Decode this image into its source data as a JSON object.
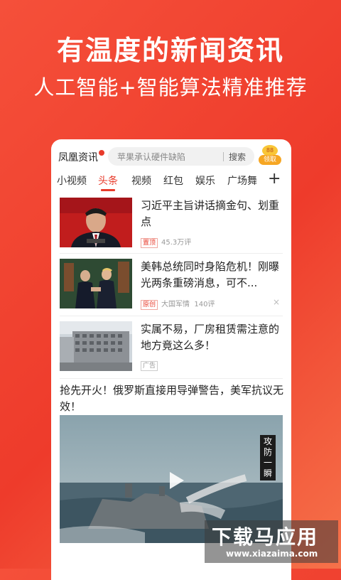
{
  "hero": {
    "title": "有温度的新闻资讯",
    "subtitle": "人工智能+智能算法精准推荐"
  },
  "topbar": {
    "logo": "凤凰资讯",
    "search_placeholder": "苹果承认硬件缺陷",
    "search_button": "搜索",
    "coin_label": "领取",
    "coin_badge": "88"
  },
  "tabs": [
    {
      "label": "小视频",
      "active": false
    },
    {
      "label": "头条",
      "active": true
    },
    {
      "label": "视频",
      "active": false
    },
    {
      "label": "红包",
      "active": false
    },
    {
      "label": "娱乐",
      "active": false
    },
    {
      "label": "广场舞",
      "active": false
    }
  ],
  "tabs_more": "+",
  "feed": [
    {
      "title": "习近平主旨讲话摘金句、划重点",
      "tag": "置顶",
      "comments": "45.3万评"
    },
    {
      "title": "美韩总统同时身陷危机！刚曝光两条重磅消息，可不...",
      "tag": "原创",
      "source": "大国军情",
      "comments": "140评",
      "close": "×"
    },
    {
      "title": "实属不易，厂房租赁需注意的地方竟这么多！",
      "tag": "广告"
    }
  ],
  "video_item": {
    "title": "抢先开火！俄罗斯直接用导弹警告，美军抗议无效！",
    "caption": "攻防一瞬"
  },
  "watermark": {
    "main": "下载马应用",
    "url": "www.xiazaima.com"
  }
}
